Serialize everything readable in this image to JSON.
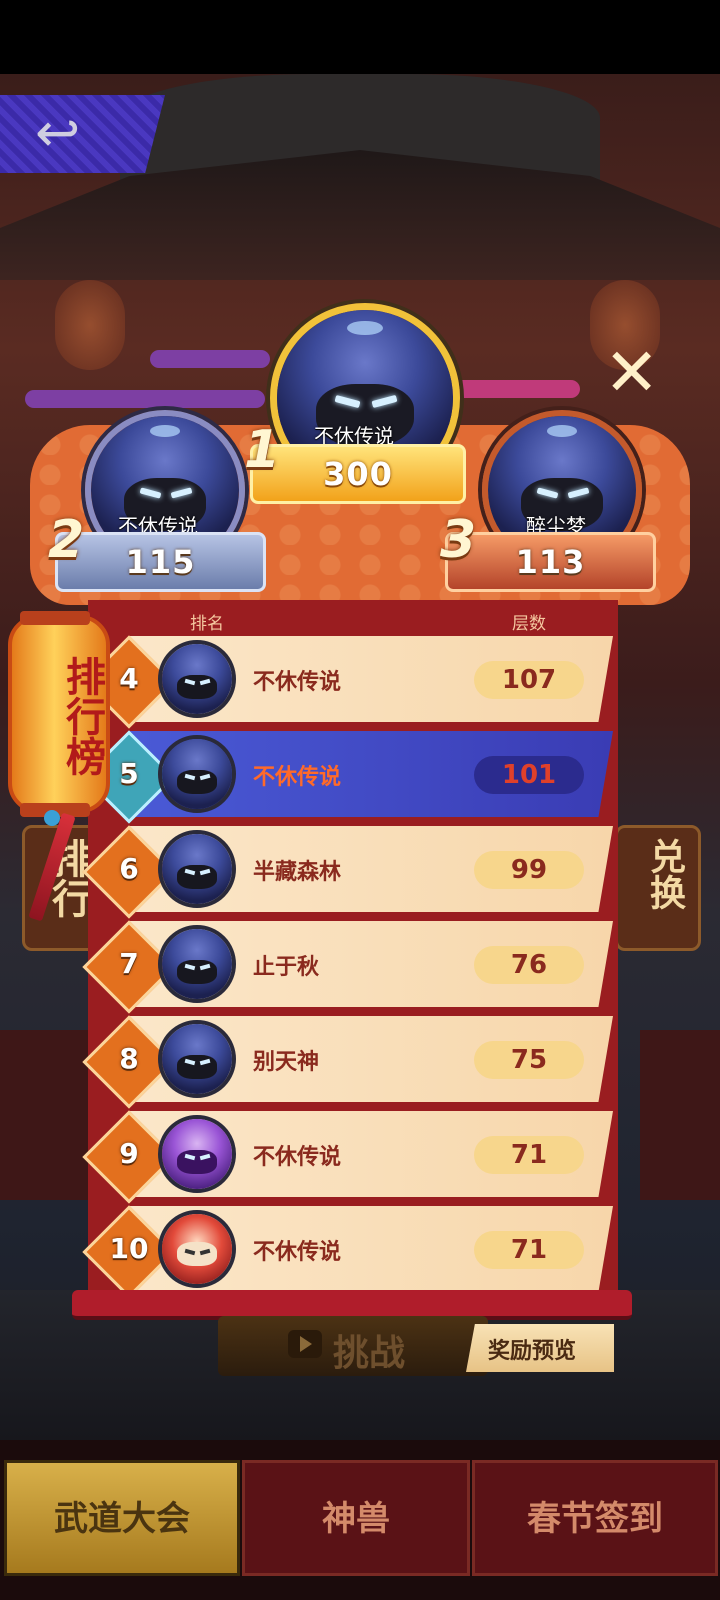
{
  "podium": {
    "first": {
      "rank": "1",
      "name": "不休传说",
      "score": "300"
    },
    "second": {
      "rank": "2",
      "name": "不休传说",
      "score": "115"
    },
    "third": {
      "rank": "3",
      "name": "醉尘梦",
      "score": "113"
    }
  },
  "lantern_label": "排行榜",
  "columns": {
    "rank": "排名",
    "score": "层数"
  },
  "rows": [
    {
      "rank": "4",
      "name": "不休传说",
      "score": "107",
      "avatar": "masked-ninja",
      "is_me": false
    },
    {
      "rank": "5",
      "name": "不休传说",
      "score": "101",
      "avatar": "masked-ninja",
      "is_me": true
    },
    {
      "rank": "6",
      "name": "半藏森林",
      "score": "99",
      "avatar": "masked-ninja",
      "is_me": false
    },
    {
      "rank": "7",
      "name": "止于秋",
      "score": "76",
      "avatar": "masked-ninja",
      "is_me": false
    },
    {
      "rank": "8",
      "name": "别天神",
      "score": "75",
      "avatar": "masked-ninja",
      "is_me": false
    },
    {
      "rank": "9",
      "name": "不休传说",
      "score": "71",
      "avatar": "purple-ninja",
      "is_me": false
    },
    {
      "rank": "10",
      "name": "不休传说",
      "score": "71",
      "avatar": "lion-dance",
      "is_me": false
    }
  ],
  "side_left_label": "排行",
  "side_right_label": "兑换",
  "challenge_label": "挑战",
  "reward_preview_label": "奖励预览",
  "tabs": [
    {
      "label": "武道大会",
      "active": true
    },
    {
      "label": "神兽",
      "active": false
    },
    {
      "label": "春节签到",
      "active": false
    }
  ],
  "icons": {
    "back": "back-arrow-icon",
    "close": "close-icon",
    "challenge": "video-play-icon"
  },
  "colors": {
    "panel": "#9a1d20",
    "row": "#fbe7c9",
    "highlight_row": "#4a5ad6",
    "rank_diamond": "#e3701e",
    "gold": "#f2a21a"
  }
}
